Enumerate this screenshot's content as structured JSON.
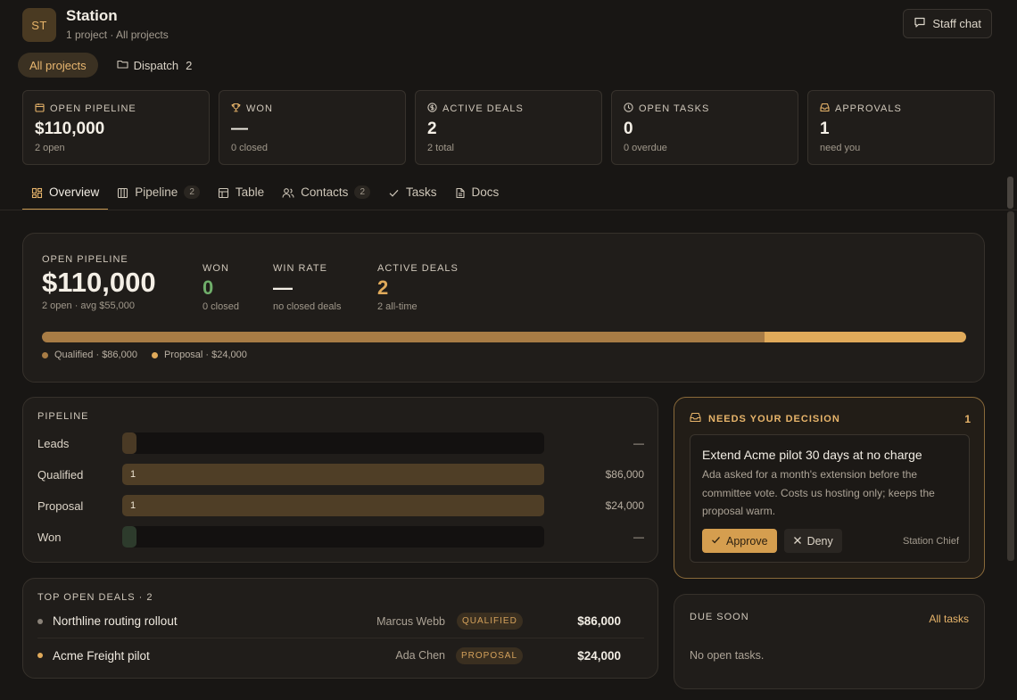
{
  "app": {
    "initials": "ST",
    "title": "Station",
    "subtitle": "1 project · All projects",
    "staff_chat": "Staff chat"
  },
  "scope": {
    "all": "All projects",
    "dispatch": "Dispatch",
    "dispatch_count": "2"
  },
  "stats": [
    {
      "label": "OPEN PIPELINE",
      "value": "$110,000",
      "sub": "2 open",
      "icon": "pipeline-icon"
    },
    {
      "label": "WON",
      "value": "—",
      "sub": "0 closed",
      "icon": "trophy-icon"
    },
    {
      "label": "ACTIVE DEALS",
      "value": "2",
      "sub": "2 total",
      "icon": "dollar-icon"
    },
    {
      "label": "OPEN TASKS",
      "value": "0",
      "sub": "0 overdue",
      "icon": "clock-icon"
    },
    {
      "label": "APPROVALS",
      "value": "1",
      "sub": "need you",
      "icon": "inbox-icon"
    }
  ],
  "tabs": [
    {
      "label": "Overview",
      "icon": "grid-icon"
    },
    {
      "label": "Pipeline",
      "count": "2",
      "icon": "columns-icon"
    },
    {
      "label": "Table",
      "icon": "table-icon"
    },
    {
      "label": "Contacts",
      "count": "2",
      "icon": "people-icon"
    },
    {
      "label": "Tasks",
      "icon": "check-icon"
    },
    {
      "label": "Docs",
      "icon": "doc-icon"
    }
  ],
  "summary": {
    "label": "OPEN PIPELINE",
    "value": "$110,000",
    "sub": "2 open · avg $55,000",
    "won_label": "WON",
    "won_value": "0",
    "won_sub": "0 closed",
    "winrate_label": "WIN RATE",
    "winrate_value": "—",
    "winrate_sub": "no closed deals",
    "active_label": " ACTIVE DEALS",
    "active_value": "2",
    "active_sub": "2 all-time",
    "segments": [
      {
        "label": "Qualified · $86,000",
        "amount": 86000,
        "color": "#a87c45"
      },
      {
        "label": "Proposal · $24,000",
        "amount": 24000,
        "color": "#e0aa5a"
      }
    ]
  },
  "pipeline": {
    "title": "PIPELINE",
    "stages": [
      {
        "name": "Leads",
        "count": "",
        "value": "—",
        "fill": 0,
        "color": "#4a3a25"
      },
      {
        "name": "Qualified",
        "count": "1",
        "value": "$86,000",
        "fill": 1,
        "color": "#4f3e26"
      },
      {
        "name": "Proposal",
        "count": "1",
        "value": "$24,000",
        "fill": 1,
        "color": "#4f3e26"
      },
      {
        "name": "Won",
        "count": "",
        "value": "—",
        "fill": 0,
        "color": "#2d3b2c"
      }
    ]
  },
  "decision": {
    "header": "NEEDS YOUR DECISION",
    "count": "1",
    "title": "Extend Acme pilot 30 days at no charge",
    "body": "Ada asked for a month's extension before the committee vote. Costs us hosting only; keeps the proposal warm.",
    "approve": "Approve",
    "deny": "Deny",
    "requester": "Station Chief"
  },
  "deals": {
    "title": "TOP OPEN DEALS · 2",
    "rows": [
      {
        "name": "Northline routing rollout",
        "owner": "Marcus Webb",
        "stage": "QUALIFIED",
        "amount": "$86,000",
        "dot": "#8a8278"
      },
      {
        "name": "Acme Freight pilot",
        "owner": "Ada Chen",
        "stage": "PROPOSAL",
        "amount": "$24,000",
        "dot": "#e0aa5a"
      }
    ]
  },
  "due": {
    "title": "DUE SOON",
    "link": "All tasks",
    "empty": "No open tasks."
  },
  "colors": {
    "accent": "#e7b46a",
    "won_green": "#6fae6a",
    "active_orange": "#e0aa5a"
  }
}
